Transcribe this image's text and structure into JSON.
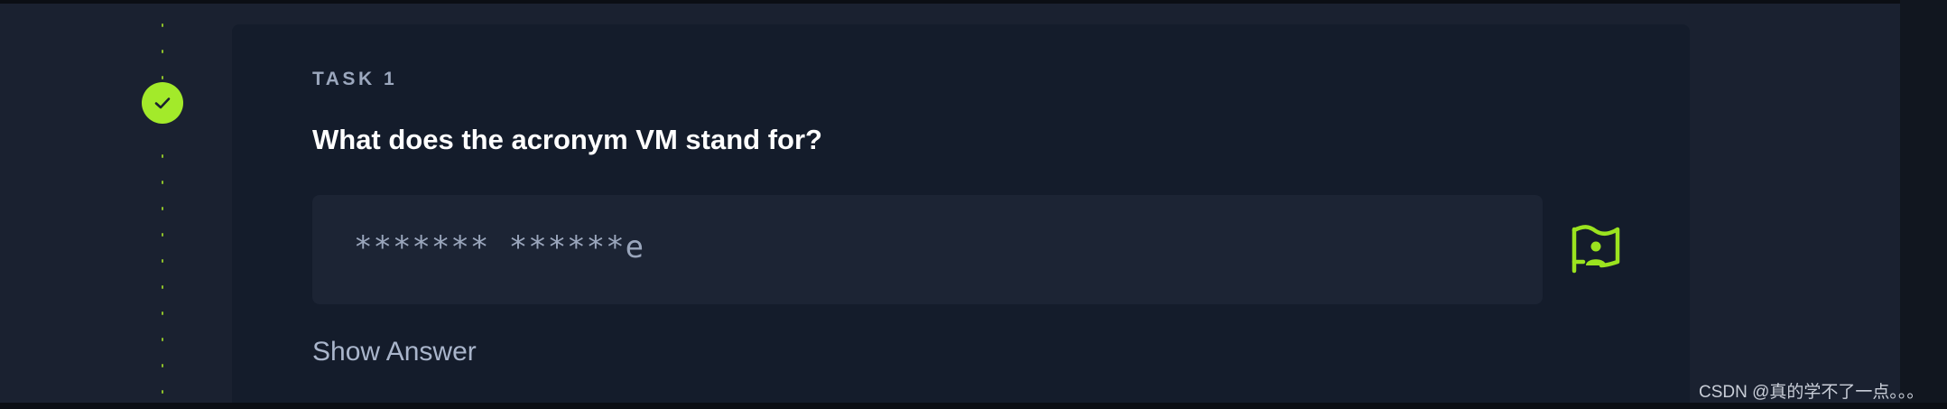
{
  "task": {
    "label": "TASK 1",
    "completed": true,
    "question": "What does the acronym VM stand for?",
    "answer_value": "******* ******e",
    "hint_icon": "flag-person-icon",
    "show_answer_label": "Show Answer"
  },
  "status_icon": "check-icon",
  "colors": {
    "accent": "#a3ea2a",
    "card_bg": "#141c2b",
    "page_bg": "#1a2130",
    "input_bg": "#1c2434"
  },
  "watermark": "CSDN @真的学不了一点。。。"
}
